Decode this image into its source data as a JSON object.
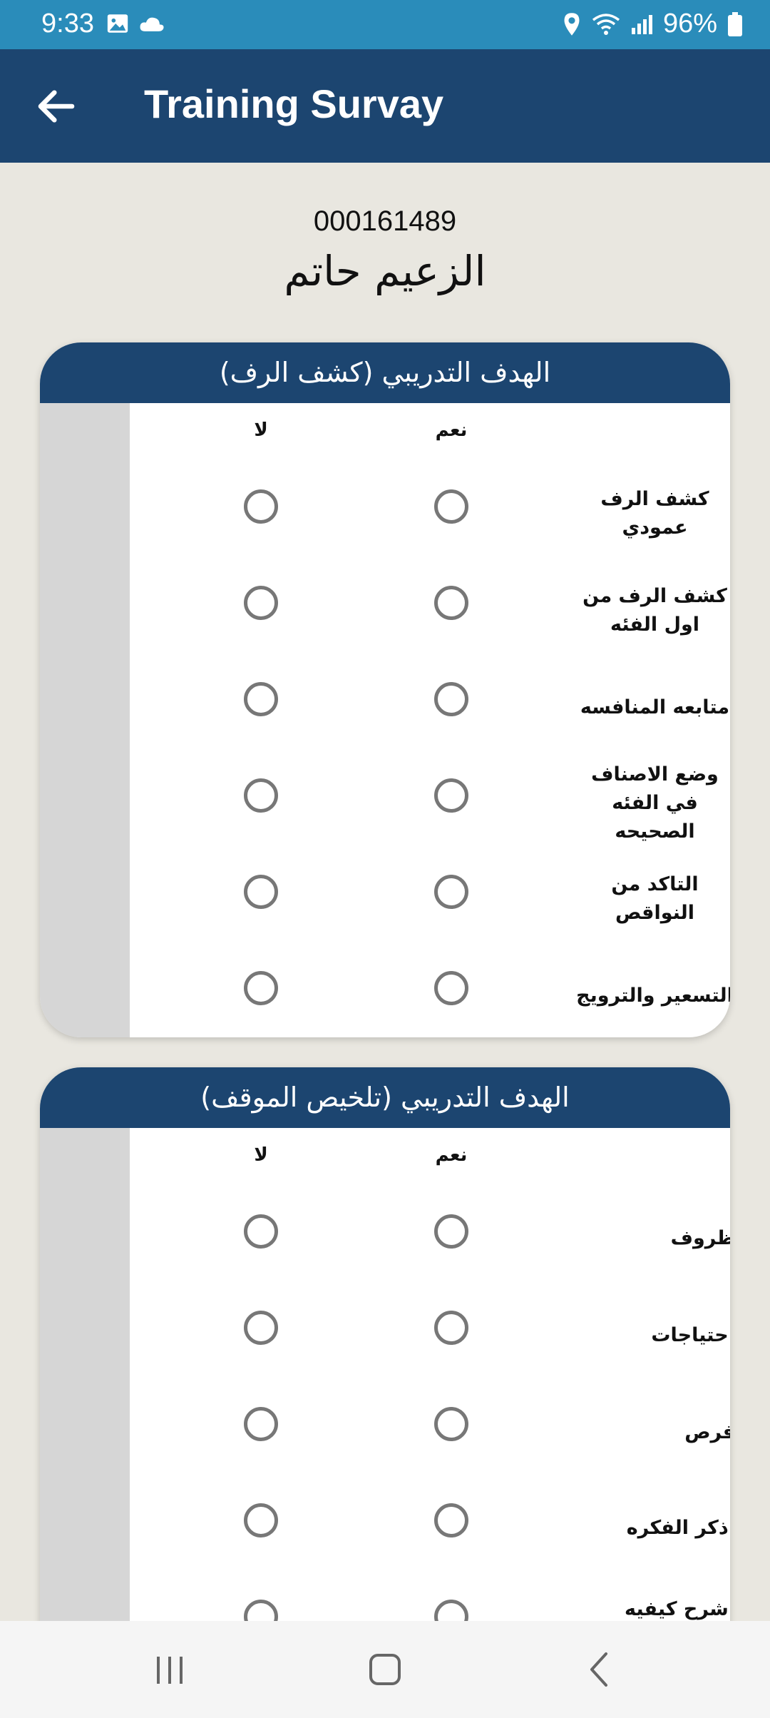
{
  "status_bar": {
    "time": "9:33",
    "battery": "96%",
    "icons": [
      "gallery-icon",
      "cloud-icon",
      "location-icon",
      "wifi-icon",
      "signal-icon",
      "battery-icon"
    ]
  },
  "app_bar": {
    "title": "Training Survay",
    "back_icon": "arrow-left-icon"
  },
  "employee": {
    "id": "000161489",
    "name": "الزعيم حاتم"
  },
  "sections": [
    {
      "title": "الهدف التدريبي (كشف الرف)",
      "yes_label": "نعم",
      "no_label": "لا",
      "questions": [
        {
          "label": "كشف الرف عمودي",
          "answer": null
        },
        {
          "label": "كشف الرف من اول الفئه",
          "answer": null
        },
        {
          "label": "متابعه المنافسه",
          "answer": null
        },
        {
          "label": "وضع الاصناف في الفئه الصحيحه",
          "answer": null
        },
        {
          "label": "التاكد من النواقص",
          "answer": null
        },
        {
          "label": "التسعير والترويج",
          "answer": null
        }
      ]
    },
    {
      "title": "الهدف التدريبي (تلخيص الموقف)",
      "yes_label": "نعم",
      "no_label": "لا",
      "questions": [
        {
          "label": "ظروف",
          "answer": null
        },
        {
          "label": "احتياجات",
          "answer": null
        },
        {
          "label": "فرص",
          "answer": null
        },
        {
          "label": "اذكر الفكره",
          "answer": null
        },
        {
          "label": "اشرح كيفيه تنفيذ",
          "answer": null
        }
      ]
    }
  ],
  "colors": {
    "status_bar": "#2a8cba",
    "app_bar": "#1c4570",
    "background": "#e9e7e0",
    "radio_border": "#777777"
  }
}
